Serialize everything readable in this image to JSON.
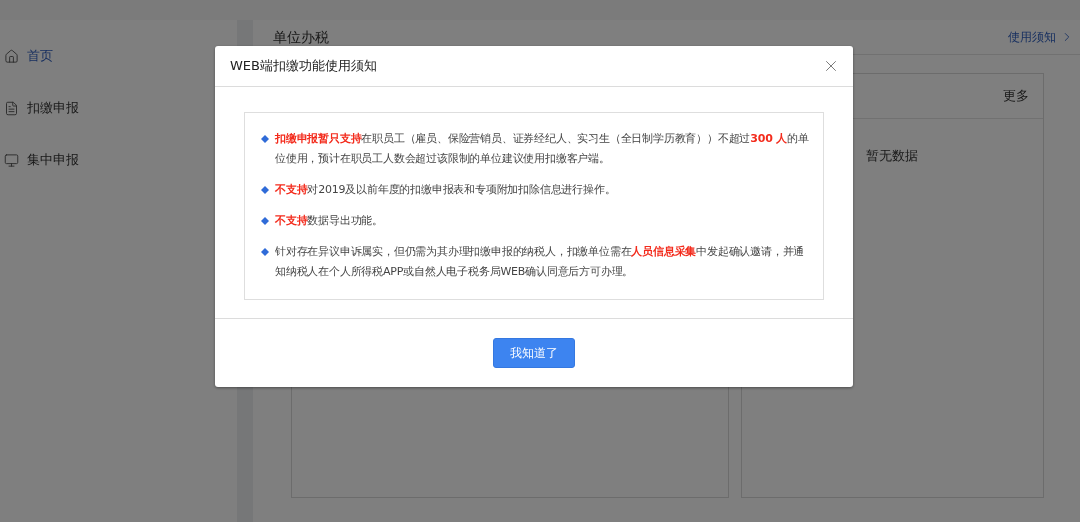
{
  "sidebar": {
    "items": [
      {
        "label": "首页",
        "kind": "home",
        "selected": true
      },
      {
        "label": "扣缴申报",
        "kind": "report",
        "selected": false
      },
      {
        "label": "集中申报",
        "kind": "screen",
        "selected": false
      }
    ]
  },
  "main": {
    "title": "单位办税",
    "notice_link": "使用须知",
    "right_card": {
      "more": "更多",
      "empty": "暂无数据"
    }
  },
  "dialog": {
    "title": "WEB端扣缴功能使用须知",
    "notices": [
      "**扣缴申报暂只支持**在职员工（雇员、保险营销员、证券经纪人、实习生（全日制学历教育））不超过**300 人**的单位使用，预计在职员工人数会超过该限制的单位建议使用扣缴客户端。",
      "**不支持**对2019及以前年度的扣缴申报表和专项附加扣除信息进行操作。",
      "**不支持**数据导出功能。",
      "针对存在异议申诉属实，但仍需为其办理扣缴申报的纳税人，扣缴单位需在**人员信息采集**中发起确认邀请，并通知纳税人在个人所得税APP或自然人电子税务局WEB确认同意后方可办理。"
    ],
    "confirm": "我知道了"
  }
}
